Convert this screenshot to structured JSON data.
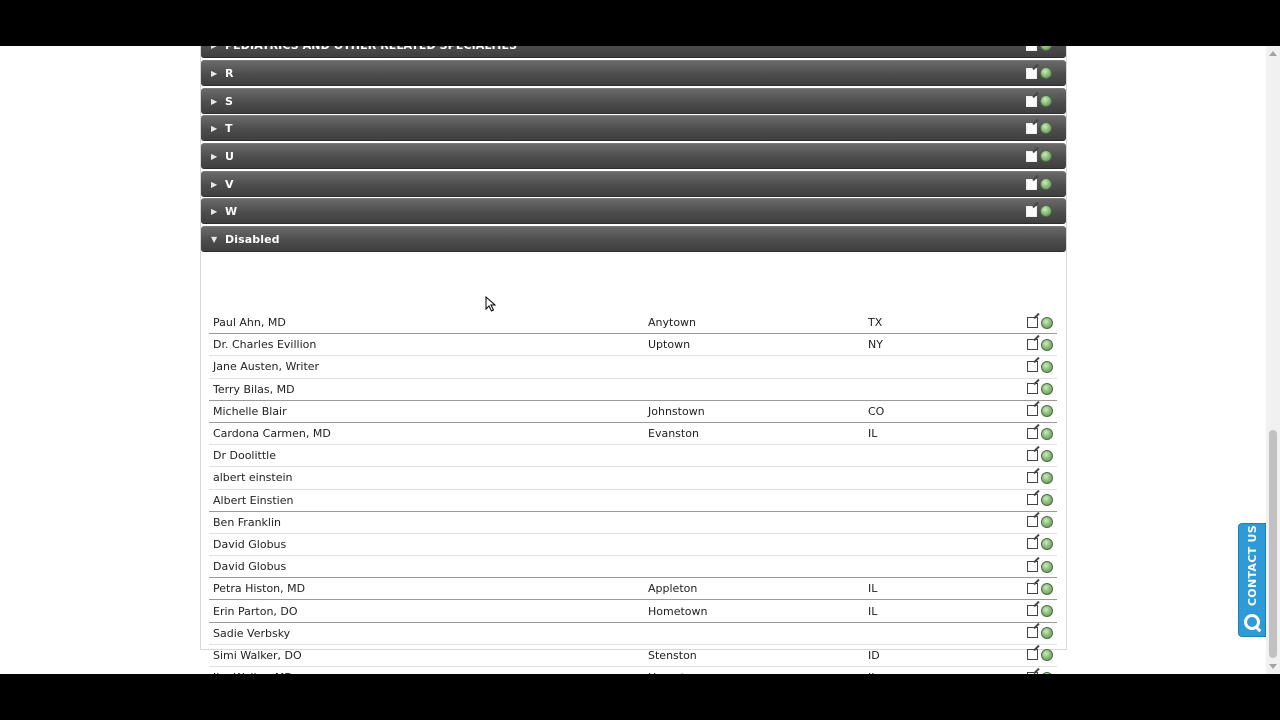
{
  "groups": [
    {
      "label": "PEDIATRICS AND OTHER RELATED SPECIALTIES",
      "expanded": false
    },
    {
      "label": "R",
      "expanded": false
    },
    {
      "label": "S",
      "expanded": false
    },
    {
      "label": "T",
      "expanded": false
    },
    {
      "label": "U",
      "expanded": false
    },
    {
      "label": "V",
      "expanded": false
    },
    {
      "label": "W",
      "expanded": false
    },
    {
      "label": "Disabled",
      "expanded": true
    }
  ],
  "disabled_rows": [
    {
      "name": "Paul Ahn, MD",
      "city": "Anytown",
      "state": "TX"
    },
    {
      "name": "Dr. Charles Evillion",
      "city": "Uptown",
      "state": "NY"
    },
    {
      "name": "Jane Austen, Writer",
      "city": "",
      "state": ""
    },
    {
      "name": "Terry Bilas, MD",
      "city": "",
      "state": ""
    },
    {
      "name": "Michelle Blair",
      "city": "Johnstown",
      "state": "CO"
    },
    {
      "name": "Cardona Carmen, MD",
      "city": "Evanston",
      "state": "IL"
    },
    {
      "name": "Dr Doolittle",
      "city": "",
      "state": ""
    },
    {
      "name": "albert einstein",
      "city": "",
      "state": ""
    },
    {
      "name": "Albert Einstien",
      "city": "",
      "state": ""
    },
    {
      "name": "Ben Franklin",
      "city": "",
      "state": ""
    },
    {
      "name": "David Globus",
      "city": "",
      "state": ""
    },
    {
      "name": "David Globus",
      "city": "",
      "state": ""
    },
    {
      "name": "Petra Histon, MD",
      "city": "Appleton",
      "state": "IL"
    },
    {
      "name": "Erin Parton, DO",
      "city": "Hometown",
      "state": "IL"
    },
    {
      "name": "Sadie Verbsky",
      "city": "",
      "state": ""
    },
    {
      "name": "Simi Walker, DO",
      "city": "Stenston",
      "state": "ID"
    },
    {
      "name": "Jim Waller, MD",
      "city": "Hometown",
      "state": "IL"
    }
  ],
  "icons": {
    "edit": "edit-icon",
    "delete": "trash-icon",
    "collapsed": "caret-right-icon",
    "expanded": "caret-down-icon"
  },
  "contact_tab": {
    "label": "CONTACT US",
    "color": "#2e9ad8"
  },
  "colors": {
    "header_bg": "#4d4d4d",
    "header_text": "#ffffff",
    "page_bg": "#ffffff"
  }
}
